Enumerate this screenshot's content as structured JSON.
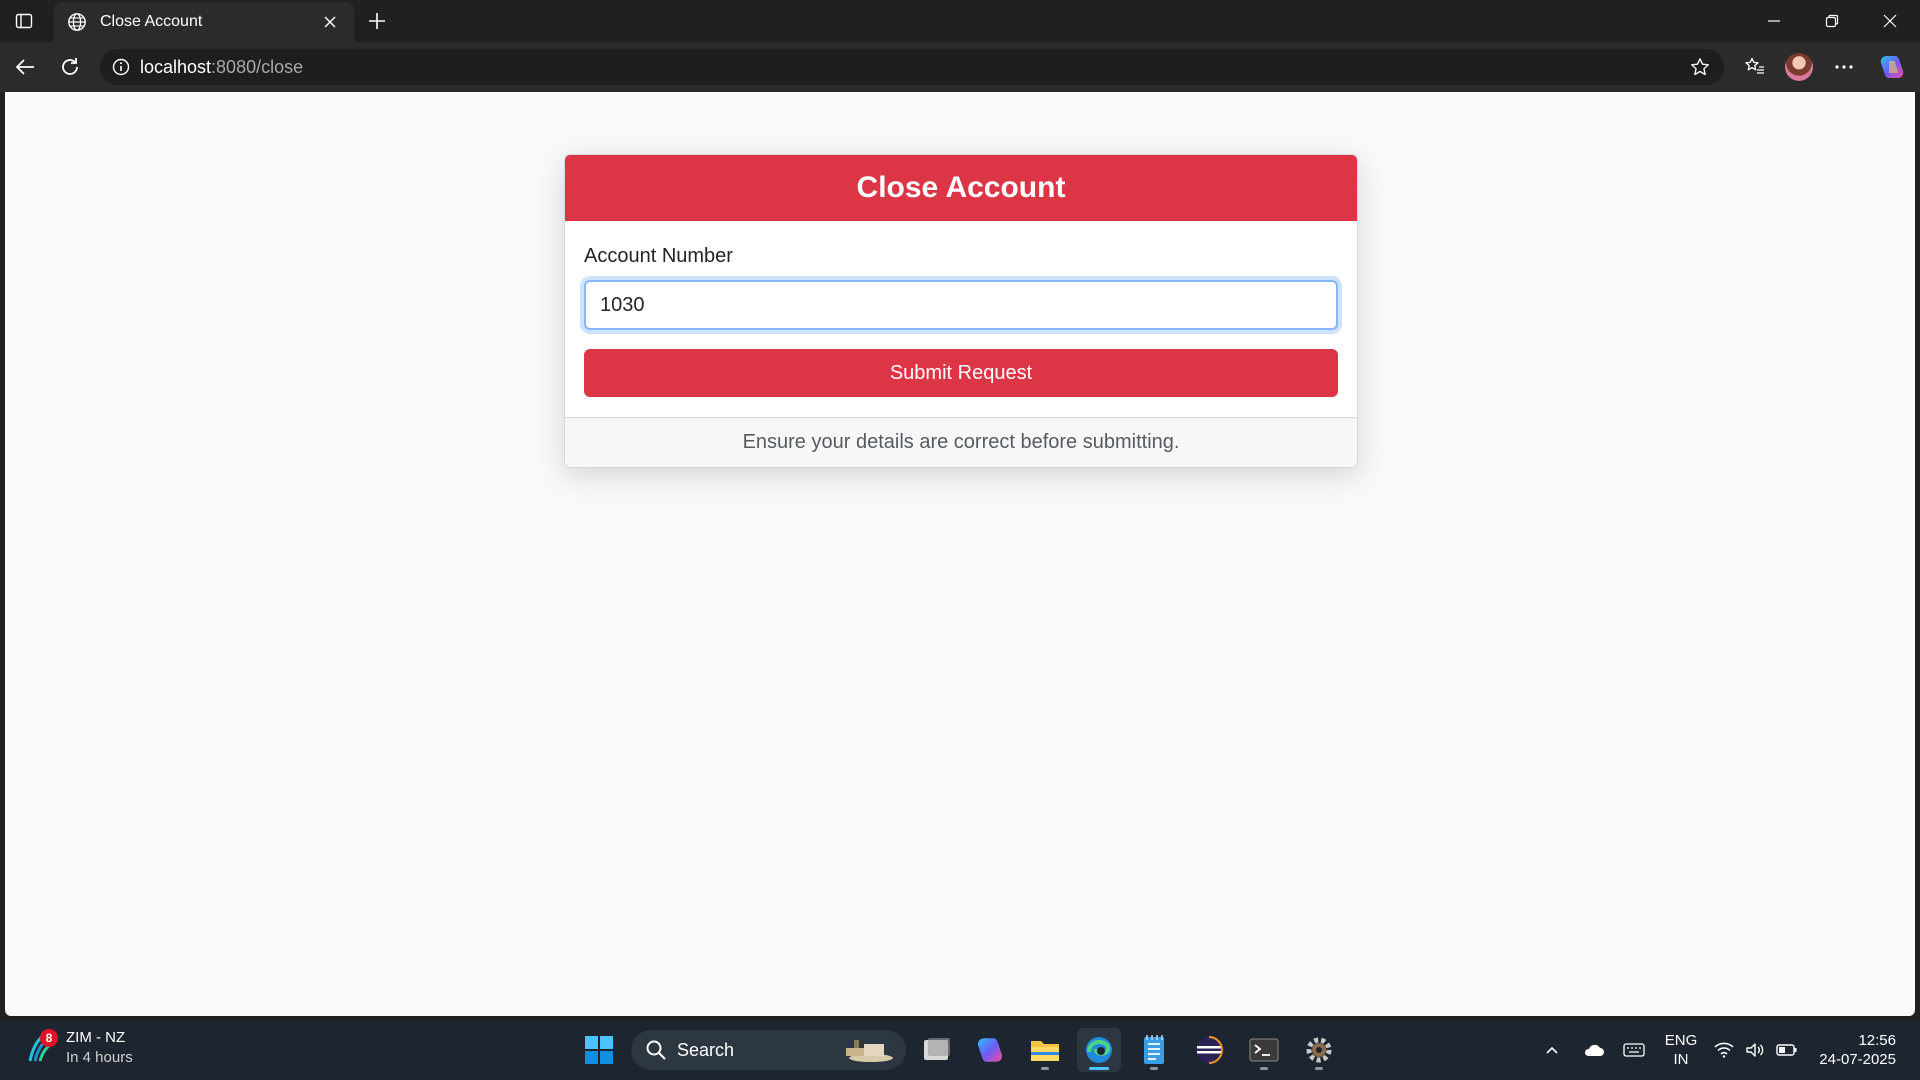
{
  "browser": {
    "tab_title": "Close Account",
    "url_host": "localhost",
    "url_path": ":8080/close"
  },
  "page": {
    "card_title": "Close Account",
    "account_label": "Account Number",
    "account_value": "1030",
    "submit_label": "Submit Request",
    "footer_note": "Ensure your details are correct before submitting."
  },
  "colors": {
    "danger": "#dc3545",
    "page_bg": "#f8f9fa",
    "focus_ring": "#86b7fe"
  },
  "taskbar": {
    "weather_title": "ZIM - NZ",
    "weather_sub": "In 4 hours",
    "weather_badge": "8",
    "search_label": "Search",
    "lang_1": "ENG",
    "lang_2": "IN",
    "time": "12:56",
    "date": "24-07-2025",
    "apps": [
      "task-view",
      "copilot",
      "file-explorer",
      "edge",
      "notepad",
      "eclipse",
      "terminal",
      "settings"
    ]
  }
}
